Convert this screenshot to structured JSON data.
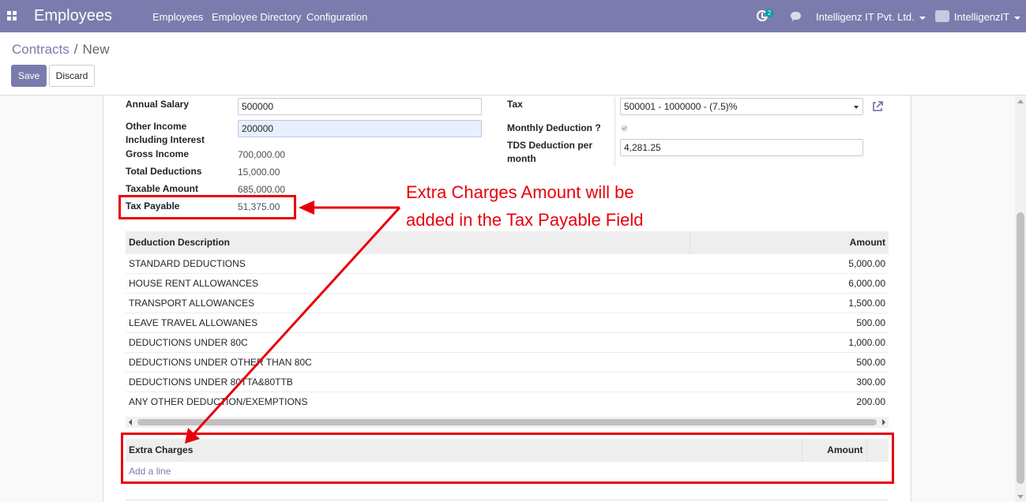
{
  "navbar": {
    "app_title": "Employees",
    "menu": [
      "Employees",
      "Employee Directory",
      "Configuration"
    ],
    "activity_badge": "2",
    "company": "Intelligenz IT Pvt. Ltd.",
    "user": "IntelligenzIT"
  },
  "breadcrumb": {
    "parent": "Contracts",
    "separator": "/",
    "current": "New"
  },
  "buttons": {
    "save": "Save",
    "discard": "Discard"
  },
  "form": {
    "annual_salary_label": "Annual Salary",
    "annual_salary_value": "500000",
    "other_income_label": "Other Income Including Interest",
    "other_income_value": "200000",
    "gross_income_label": "Gross Income",
    "gross_income_value": "700,000.00",
    "total_deductions_label": "Total Deductions",
    "total_deductions_value": "15,000.00",
    "taxable_amount_label": "Taxable Amount",
    "taxable_amount_value": "685,000.00",
    "tax_payable_label": "Tax Payable",
    "tax_payable_value": "51,375.00",
    "tax_label": "Tax",
    "tax_value": "500001 - 1000000 - (7.5)%",
    "monthly_deduction_label": "Monthly Deduction ?",
    "monthly_deduction_checked": true,
    "tds_label": "TDS Deduction per month",
    "tds_value": "4,281.25"
  },
  "deductions": {
    "headers": [
      "Deduction Description",
      "Amount"
    ],
    "rows": [
      {
        "desc": "STANDARD DEDUCTIONS",
        "amount": "5,000.00"
      },
      {
        "desc": "HOUSE RENT ALLOWANCES",
        "amount": "6,000.00"
      },
      {
        "desc": "TRANSPORT ALLOWANCES",
        "amount": "1,500.00"
      },
      {
        "desc": "LEAVE TRAVEL ALLOWANES",
        "amount": "500.00"
      },
      {
        "desc": "DEDUCTIONS UNDER 80C",
        "amount": "1,000.00"
      },
      {
        "desc": "DEDUCTIONS UNDER OTHER THAN 80C",
        "amount": "500.00"
      },
      {
        "desc": "DEDUCTIONS UNDER 80TTA&80TTB",
        "amount": "300.00"
      },
      {
        "desc": "ANY OTHER DEDUCTION/EXEMPTIONS",
        "amount": "200.00"
      }
    ]
  },
  "extra_charges": {
    "headers": [
      "Extra Charges",
      "Amount"
    ],
    "add_line": "Add a line"
  },
  "annotation": {
    "line1": "Extra Charges Amount will be",
    "line2": "added in the Tax Payable Field",
    "color": "#e8000b"
  },
  "colors": {
    "brand": "#7c7bad",
    "accent_teal": "#00a09d"
  }
}
